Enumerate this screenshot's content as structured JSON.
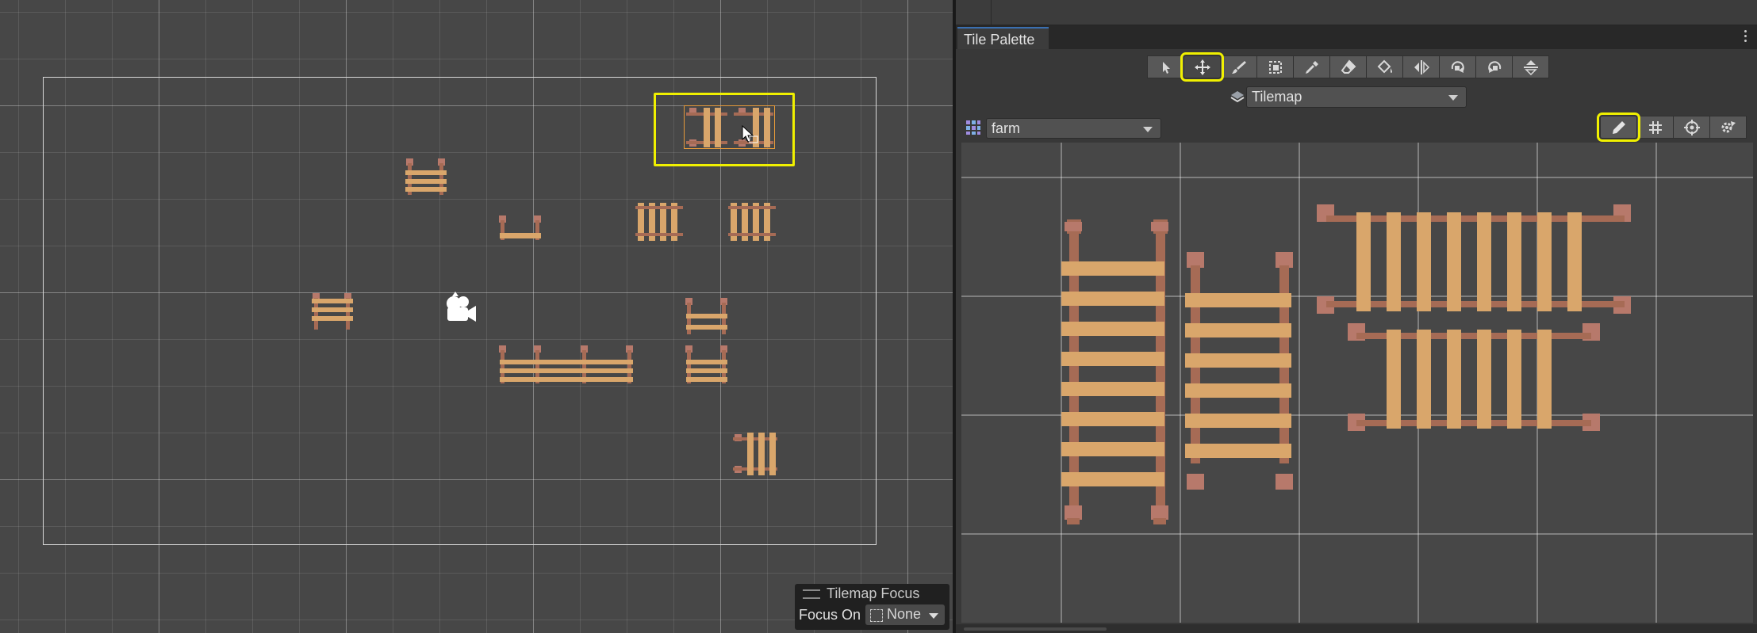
{
  "scene": {
    "overlay": {
      "title": "Tilemap Focus",
      "focus_label": "Focus On",
      "focus_value": "None"
    }
  },
  "palette_window": {
    "tab_title": "Tile Palette",
    "tools": [
      "select-tool",
      "move-tool",
      "paint-brush-tool",
      "box-fill-tool",
      "pick-tool",
      "erase-tool",
      "fill-tool",
      "flip-x-tool",
      "rotate-clockwise-tool",
      "rotate-counterclockwise-tool",
      "flip-y-tool"
    ],
    "active_tool": "move-tool",
    "active_target": "Tilemap",
    "palette_name": "farm",
    "right_tools": [
      "edit-palette-pencil",
      "grid-toggle",
      "gizmo-toggle",
      "settings"
    ]
  },
  "colors": {
    "highlight": "#f0f000",
    "wood_light": "#d9a66b",
    "wood_dark": "#a66b55",
    "post": "#b7796b"
  }
}
